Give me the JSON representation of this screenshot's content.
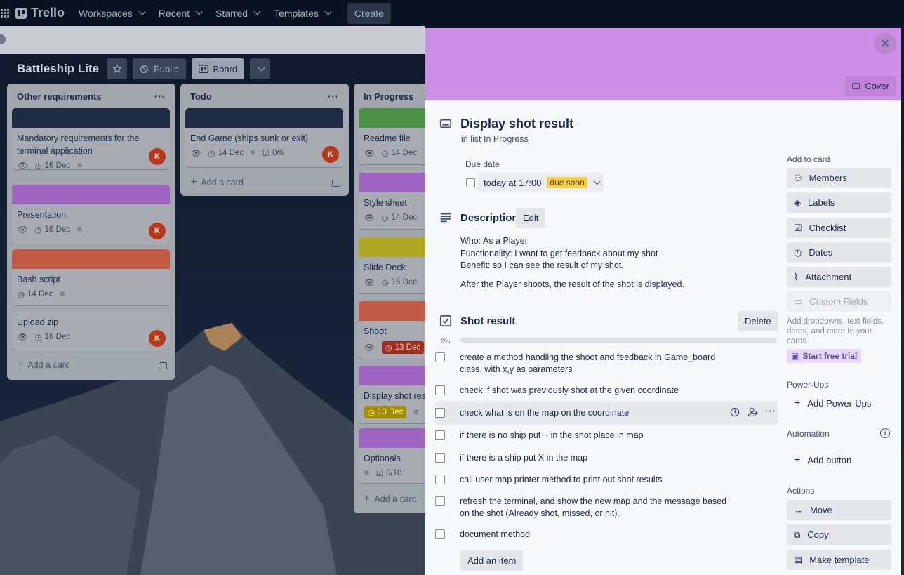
{
  "nav": {
    "logo": "Trello",
    "workspaces": "Workspaces",
    "recent": "Recent",
    "starred": "Starred",
    "templates": "Templates",
    "create": "Create"
  },
  "board": {
    "title": "Battleship Lite",
    "visibility": "Public",
    "view": "Board"
  },
  "lists": [
    {
      "name": "Other requirements",
      "cards": [
        {
          "title": "Mandatory requirements for the terminal application",
          "cover": "#1d2b45",
          "date": "16 Dec",
          "avatar": "K"
        },
        {
          "title": "Presentation",
          "cover": "#9f63c2",
          "date": "16 Dec",
          "avatar": "K"
        },
        {
          "title": "Bash script",
          "cover": "#c25a46",
          "date": "14 Dec"
        },
        {
          "title": "Upload zip",
          "date": "16 Dec",
          "avatar": "K"
        }
      ],
      "add": "Add a card"
    },
    {
      "name": "Todo",
      "cards": [
        {
          "title": "End Game (ships sunk or exit)",
          "cover": "#1d2b45",
          "date": "14 Dec",
          "checklist": "0/6",
          "avatar": "K"
        }
      ],
      "add": "Add a card"
    },
    {
      "name": "In Progress",
      "cards": [
        {
          "title": "Readme file",
          "cover": "#4b9146",
          "date": "14 Dec"
        },
        {
          "title": "Style sheet",
          "cover": "#9f63c2",
          "date": "14 Dec"
        },
        {
          "title": "Slide Deck",
          "cover": "#aea822",
          "date": "15 Dec"
        },
        {
          "title": "Shoot",
          "cover": "#c25a46",
          "date": "13 Dec"
        },
        {
          "title": "Display shot resu",
          "cover": "#9f63c2",
          "date": "13 Dec"
        },
        {
          "title": "Optionals",
          "cover": "#9f63c2",
          "checklist": "0/10"
        }
      ],
      "add": "Add a card"
    }
  ],
  "modal": {
    "cover_color": "#cd8fe7",
    "cover_button": "Cover",
    "title": "Display shot result",
    "in_list_prefix": "in list",
    "in_list": "In Progress",
    "due_label": "Due date",
    "due_value": "today at 17:00",
    "due_badge": "due soon",
    "description_title": "Description",
    "edit": "Edit",
    "desc_lines": [
      "Who: As a Player",
      "Functionality: I want to get feedback about my shot",
      "Benefit: so I can see the result of my shot."
    ],
    "desc_extra": "After the Player shoots, the result of the shot is displayed.",
    "checklist_title": "Shot result",
    "delete": "Delete",
    "progress": "0%",
    "items": [
      "create a method handling the shoot and feedback in Game_board class, with x,y as parameters",
      "check if shot was previously shot at the given coordinate",
      "check what is on the map on the coordinate",
      "if there is no ship put ~ in the shot place in map",
      "if there is a ship put X in the map",
      "call user map printer method to print out shot results",
      "refresh the terminal, and show the new map and the message based on the shot (Already shot, missed, or hit).",
      "document method"
    ],
    "add_item": "Add an item",
    "sidebar": {
      "add_to_card": "Add to card",
      "members": "Members",
      "labels": "Labels",
      "checklist": "Checklist",
      "dates": "Dates",
      "attachment": "Attachment",
      "custom_fields": "Custom Fields",
      "custom_hint": "Add dropdowns, text fields, dates, and more to your cards.",
      "trial": "Start free trial",
      "powerups": "Power-Ups",
      "add_powerups": "Add Power-Ups",
      "automation": "Automation",
      "add_button": "Add button",
      "actions": "Actions",
      "move": "Move",
      "copy": "Copy",
      "make_template": "Make template"
    }
  }
}
